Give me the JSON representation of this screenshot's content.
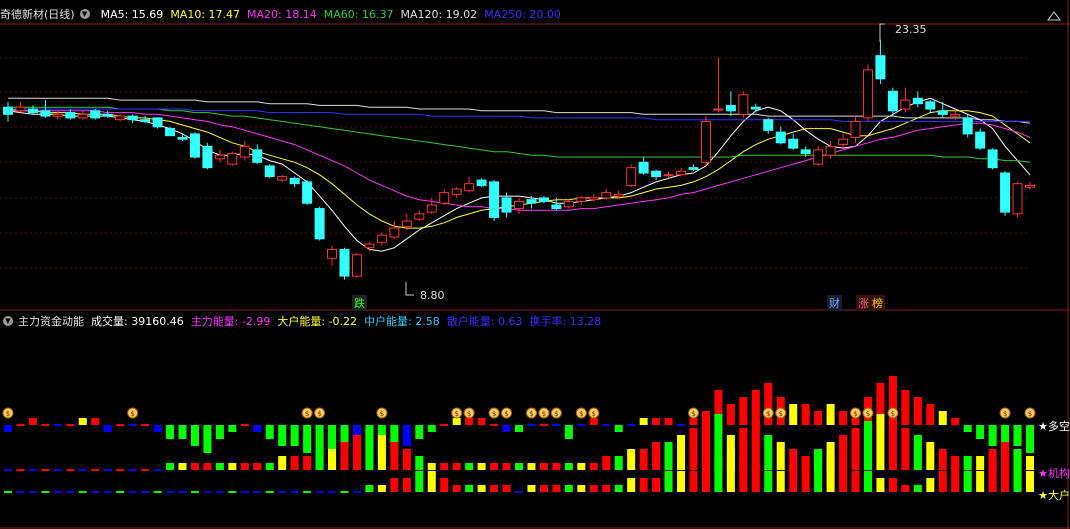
{
  "top_panel": {
    "title": "奇德新材(日线)",
    "ma": [
      {
        "label": "MA5: 15.69",
        "color": "#ffffff"
      },
      {
        "label": "MA10: 17.47",
        "color": "#ffff33"
      },
      {
        "label": "MA20: 18.14",
        "color": "#ff33ff"
      },
      {
        "label": "MA60: 16.37",
        "color": "#33cc33"
      },
      {
        "label": "MA120: 19.02",
        "color": "#dddddd"
      },
      {
        "label": "MA250: 20.00",
        "color": "#3333ff"
      }
    ],
    "high_label": "23.35",
    "low_label": "8.80",
    "tags": [
      {
        "text": "跌",
        "color": "#33ff33"
      },
      {
        "text": "财",
        "color": "#66aaff"
      },
      {
        "text": "涨",
        "color": "#ff5555"
      },
      {
        "text": "榜",
        "color": "#ffcc00"
      }
    ]
  },
  "bottom_panel": {
    "title": "主力资金动能",
    "items": [
      {
        "label": "成交量: 39160.46",
        "color": "#ffffff"
      },
      {
        "label": "主力能量: -2.99",
        "color": "#ff33ff"
      },
      {
        "label": "大户能量: -0.22",
        "color": "#ffff33"
      },
      {
        "label": "中户能量: 2.58",
        "color": "#33ccff"
      },
      {
        "label": "散户能量: 0.63",
        "color": "#3333ff"
      },
      {
        "label": "换手率: 13.28",
        "color": "#3333ff"
      }
    ],
    "right_labels": [
      {
        "text": "★多空",
        "color": "#ffffff"
      },
      {
        "text": "★机构",
        "color": "#ff33ff"
      },
      {
        "text": "★大户",
        "color": "#ffff33"
      }
    ]
  },
  "chart_data": {
    "type": "candlestick",
    "candles": [
      [
        11,
        10.6,
        11.3,
        10.2
      ],
      [
        10.8,
        11,
        11.3,
        10.7
      ],
      [
        10.9,
        10.7,
        11.1,
        10.6
      ],
      [
        10.8,
        10.5,
        11.4,
        10.4
      ],
      [
        10.5,
        10.6,
        10.8,
        10.3
      ],
      [
        10.7,
        10.4,
        10.9,
        10.3
      ],
      [
        10.4,
        10.6,
        10.8,
        10.3
      ],
      [
        10.8,
        10.4,
        10.9,
        10.3
      ],
      [
        10.6,
        10.5,
        10.8,
        10.4
      ],
      [
        10.3,
        10.5,
        10.6,
        10.2
      ],
      [
        10.5,
        10.3,
        10.6,
        10.1
      ],
      [
        10.3,
        10.2,
        10.5,
        10.1
      ],
      [
        10.4,
        9.9,
        10.4,
        9.8
      ],
      [
        9.8,
        9.4,
        9.9,
        9.4
      ],
      [
        9.3,
        9.2,
        9.5,
        9.1
      ],
      [
        9.5,
        8.2,
        9.6,
        8.1
      ],
      [
        8.8,
        7.6,
        9,
        7.5
      ],
      [
        8.1,
        8.3,
        8.6,
        7.9
      ],
      [
        7.8,
        8.4,
        8.5,
        7.7
      ],
      [
        8.2,
        8.8,
        9.1,
        8
      ],
      [
        8.6,
        7.9,
        8.9,
        7.8
      ],
      [
        7.7,
        7.1,
        7.8,
        7.0
      ],
      [
        6.9,
        7.1,
        7.2,
        6.8
      ],
      [
        7,
        6.7,
        7.1,
        6.5
      ],
      [
        6.8,
        5.6,
        6.9,
        5.5
      ],
      [
        5.3,
        3.6,
        5.4,
        3.5
      ],
      [
        2.5,
        3,
        3.2,
        2.1
      ],
      [
        3,
        1.5,
        3.1,
        1.3
      ],
      [
        1.5,
        2.7,
        2.8,
        1.4
      ],
      [
        3.1,
        3.3,
        3.4,
        2.9
      ],
      [
        3.4,
        3.8,
        4,
        3.2
      ],
      [
        3.7,
        4.2,
        4.6,
        3.6
      ],
      [
        4.3,
        4.6,
        5,
        4.1
      ],
      [
        4.7,
        5,
        5.2,
        4.6
      ],
      [
        5.1,
        5.5,
        5.9,
        5
      ],
      [
        5.6,
        6.2,
        6.4,
        5.5
      ],
      [
        6.1,
        6.4,
        6.5,
        5.9
      ],
      [
        6.3,
        6.7,
        7.1,
        6.2
      ],
      [
        6.9,
        6.6,
        7,
        6.5
      ],
      [
        6.8,
        4.8,
        6.9,
        4.6
      ],
      [
        5.9,
        5.1,
        6.2,
        4.8
      ],
      [
        5.3,
        5.7,
        5.9,
        5
      ],
      [
        5.8,
        5.6,
        6,
        5.3
      ],
      [
        5.9,
        5.7,
        6,
        5.6
      ],
      [
        5.5,
        5.3,
        5.9,
        5.2
      ],
      [
        5.4,
        5.7,
        5.8,
        5.3
      ],
      [
        5.7,
        5.9,
        6.0,
        5.5
      ],
      [
        5.8,
        5.9,
        6.1,
        5.7
      ],
      [
        5.9,
        6.2,
        6.4,
        5.8
      ],
      [
        6,
        6.1,
        6.3,
        5.9
      ],
      [
        6.6,
        7.6,
        7.8,
        6.5
      ],
      [
        7.9,
        7.3,
        8.2,
        7.2
      ],
      [
        7.4,
        7.1,
        7.5,
        6.9
      ],
      [
        7.2,
        7.2,
        7.4,
        7.0
      ],
      [
        7.2,
        7.4,
        7.6,
        7.1
      ],
      [
        7.6,
        7.5,
        7.8,
        7.4
      ],
      [
        7.9,
        10.2,
        10.5,
        7.7
      ],
      [
        10.9,
        10.9,
        13.8,
        10.7
      ],
      [
        11.1,
        10.8,
        11.9,
        10.5
      ],
      [
        10.6,
        11.7,
        11.9,
        10.4
      ],
      [
        11,
        10.9,
        11.2,
        10.7
      ],
      [
        10.3,
        9.7,
        10.4,
        9.5
      ],
      [
        9.6,
        9,
        9.9,
        8.9
      ],
      [
        9.2,
        8.7,
        9.5,
        8.6
      ],
      [
        8.6,
        8.4,
        8.8,
        8.2
      ],
      [
        7.8,
        8.6,
        8.8,
        7.7
      ],
      [
        8.3,
        8.8,
        9.1,
        8.1
      ],
      [
        8.9,
        9.2,
        9.5,
        8.7
      ],
      [
        9.3,
        10.2,
        10.5,
        9
      ],
      [
        10.4,
        13.1,
        13.4,
        10.2
      ],
      [
        13.9,
        12.6,
        14.8,
        12.3
      ],
      [
        11.9,
        10.8,
        12.1,
        10.5
      ],
      [
        10.9,
        11.4,
        12.1,
        10.7
      ],
      [
        11.5,
        11.2,
        11.9,
        11.0
      ],
      [
        11.3,
        10.9,
        11.4,
        10.7
      ],
      [
        10.8,
        10.6,
        11.3,
        10.4
      ],
      [
        10.5,
        10.6,
        10.9,
        10.3
      ],
      [
        10.4,
        9.5,
        10.6,
        9.3
      ],
      [
        9.6,
        8.7,
        9.8,
        8.6
      ],
      [
        8.6,
        7.6,
        8.7,
        7.5
      ],
      [
        7.3,
        5.1,
        7.4,
        4.9
      ],
      [
        5.0,
        6.7,
        6.8,
        4.8
      ],
      [
        6.5,
        6.6,
        6.8,
        6.4
      ]
    ],
    "ma": {
      "MA5": [
        10.8,
        10.7,
        10.6,
        10.6,
        10.6,
        10.5,
        10.5,
        10.5,
        10.5,
        10.4,
        10.3,
        10.2,
        10.0,
        9.8,
        9.5,
        9.1,
        8.6,
        8.3,
        8.3,
        8.4,
        8.3,
        8.0,
        7.8,
        7.3,
        6.8,
        6.0,
        5.2,
        4.3,
        3.5,
        3.0,
        2.9,
        3.1,
        3.6,
        4.1,
        4.5,
        4.9,
        5.3,
        5.6,
        5.9,
        6.0,
        6.0,
        6.0,
        5.9,
        5.8,
        5.6,
        5.6,
        5.7,
        5.8,
        5.9,
        6.0,
        6.2,
        6.5,
        6.8,
        7.0,
        7.2,
        7.3,
        7.7,
        8.5,
        9.4,
        10.2,
        10.8,
        11.0,
        10.8,
        10.3,
        9.7,
        9.2,
        8.8,
        8.7,
        8.8,
        9.4,
        10.2,
        10.6,
        11.0,
        11.3,
        11.5,
        11.2,
        10.9,
        10.6,
        10.3,
        9.8,
        8.8,
        8.0,
        7.2
      ],
      "MA10": [
        10.9,
        10.8,
        10.8,
        10.7,
        10.7,
        10.7,
        10.6,
        10.6,
        10.6,
        10.5,
        10.4,
        10.4,
        10.3,
        10.2,
        10.0,
        9.8,
        9.6,
        9.3,
        9.0,
        8.8,
        8.5,
        8.3,
        8.1,
        7.9,
        7.6,
        7.2,
        6.7,
        6.1,
        5.5,
        5.0,
        4.6,
        4.3,
        4.2,
        4.2,
        4.3,
        4.5,
        4.8,
        5.0,
        5.2,
        5.3,
        5.4,
        5.5,
        5.6,
        5.7,
        5.8,
        5.8,
        5.9,
        5.9,
        5.9,
        5.9,
        6.0,
        6.2,
        6.4,
        6.5,
        6.6,
        6.8,
        7.1,
        7.5,
        8.0,
        8.5,
        8.9,
        9.2,
        9.4,
        9.6,
        9.8,
        9.8,
        9.8,
        9.6,
        9.4,
        9.4,
        9.6,
        9.8,
        10.1,
        10.4,
        10.7,
        10.8,
        10.8,
        10.8,
        10.7,
        10.5,
        10.0,
        9.5,
        9.0
      ],
      "MA20": [
        10.8,
        10.8,
        10.8,
        10.8,
        10.8,
        10.8,
        10.8,
        10.8,
        10.7,
        10.7,
        10.7,
        10.6,
        10.6,
        10.5,
        10.4,
        10.3,
        10.2,
        10.0,
        9.9,
        9.7,
        9.5,
        9.3,
        9.1,
        8.9,
        8.6,
        8.3,
        8.0,
        7.7,
        7.3,
        6.9,
        6.6,
        6.3,
        6.0,
        5.8,
        5.7,
        5.6,
        5.5,
        5.4,
        5.4,
        5.3,
        5.3,
        5.2,
        5.2,
        5.2,
        5.2,
        5.2,
        5.3,
        5.3,
        5.4,
        5.5,
        5.6,
        5.7,
        5.8,
        5.9,
        6.1,
        6.2,
        6.4,
        6.6,
        6.8,
        7.0,
        7.2,
        7.4,
        7.6,
        7.8,
        8.0,
        8.2,
        8.4,
        8.6,
        8.8,
        9.0,
        9.2,
        9.3,
        9.5,
        9.7,
        9.8,
        9.9,
        10.0,
        10.1,
        10.1,
        10.0,
        9.8,
        9.6,
        9.3
      ],
      "MA60": [
        11.0,
        11.0,
        11.0,
        11.0,
        11.0,
        11.0,
        11.0,
        11.0,
        11.0,
        10.9,
        10.9,
        10.9,
        10.9,
        10.8,
        10.8,
        10.7,
        10.7,
        10.6,
        10.5,
        10.5,
        10.4,
        10.3,
        10.2,
        10.1,
        10.0,
        9.9,
        9.8,
        9.7,
        9.6,
        9.5,
        9.4,
        9.3,
        9.2,
        9.1,
        9.0,
        8.9,
        8.8,
        8.7,
        8.6,
        8.5,
        8.5,
        8.4,
        8.3,
        8.3,
        8.2,
        8.2,
        8.2,
        8.2,
        8.2,
        8.2,
        8.2,
        8.2,
        8.2,
        8.2,
        8.2,
        8.2,
        8.2,
        8.2,
        8.2,
        8.3,
        8.3,
        8.3,
        8.3,
        8.3,
        8.3,
        8.3,
        8.3,
        8.3,
        8.3,
        8.3,
        8.3,
        8.3,
        8.3,
        8.3,
        8.3,
        8.2,
        8.2,
        8.2,
        8.1,
        8.1,
        8.0,
        8.0,
        7.9
      ],
      "MA120": [
        11.5,
        11.5,
        11.5,
        11.5,
        11.5,
        11.5,
        11.5,
        11.5,
        11.5,
        11.4,
        11.4,
        11.4,
        11.4,
        11.4,
        11.4,
        11.4,
        11.3,
        11.3,
        11.3,
        11.3,
        11.3,
        11.2,
        11.2,
        11.2,
        11.2,
        11.1,
        11.1,
        11.1,
        11.1,
        11.0,
        11.0,
        11.0,
        11.0,
        10.9,
        10.9,
        10.9,
        10.9,
        10.9,
        10.8,
        10.8,
        10.8,
        10.8,
        10.8,
        10.8,
        10.7,
        10.7,
        10.7,
        10.7,
        10.7,
        10.7,
        10.7,
        10.6,
        10.6,
        10.6,
        10.6,
        10.6,
        10.6,
        10.6,
        10.6,
        10.6,
        10.6,
        10.5,
        10.5,
        10.5,
        10.5,
        10.5,
        10.5,
        10.5,
        10.5,
        10.5,
        10.5,
        10.5,
        10.4,
        10.4,
        10.4,
        10.4,
        10.4,
        10.4,
        10.3,
        10.3,
        10.2,
        10.2,
        10.1
      ],
      "MA250": [
        10.9,
        10.9,
        10.9,
        10.9,
        10.9,
        10.9,
        10.9,
        10.9,
        10.9,
        10.9,
        10.9,
        10.9,
        10.9,
        10.9,
        10.9,
        10.8,
        10.8,
        10.8,
        10.8,
        10.8,
        10.8,
        10.7,
        10.7,
        10.7,
        10.7,
        10.7,
        10.7,
        10.6,
        10.6,
        10.6,
        10.6,
        10.6,
        10.6,
        10.6,
        10.5,
        10.5,
        10.5,
        10.5,
        10.5,
        10.5,
        10.5,
        10.5,
        10.4,
        10.4,
        10.4,
        10.4,
        10.4,
        10.4,
        10.4,
        10.4,
        10.4,
        10.4,
        10.3,
        10.3,
        10.3,
        10.3,
        10.3,
        10.3,
        10.3,
        10.3,
        10.3,
        10.3,
        10.3,
        10.3,
        10.3,
        10.3,
        10.3,
        10.2,
        10.2,
        10.2,
        10.2,
        10.2,
        10.2,
        10.2,
        10.2,
        10.2,
        10.2,
        10.2,
        10.2,
        10.2,
        10.2,
        10.2,
        10.2
      ]
    },
    "bars_row1": [
      -1,
      0,
      1,
      0,
      0,
      0,
      1,
      1,
      -1,
      0,
      0,
      0,
      -1,
      -2,
      -2,
      -3,
      -4,
      -2,
      -1,
      0,
      -1,
      -2,
      -3,
      -3,
      -4,
      -5,
      -6,
      -6,
      -3,
      -4,
      -5,
      -4,
      -3,
      -2,
      -1,
      0,
      1,
      1,
      1,
      0,
      -1,
      -1,
      0,
      0,
      0,
      -2,
      0,
      1,
      0,
      -1,
      0,
      1,
      1,
      1,
      0,
      1,
      2,
      5,
      3,
      4,
      5,
      6,
      4,
      3,
      3,
      2,
      3,
      2,
      1,
      4,
      6,
      7,
      5,
      4,
      3,
      2,
      1,
      -1,
      -2,
      -3,
      -5,
      -3,
      -4
    ],
    "bars_row2": [
      0,
      0,
      0,
      0,
      0,
      0,
      0,
      0,
      0,
      0,
      0,
      0,
      0,
      1,
      1,
      1,
      1,
      1,
      1,
      1,
      1,
      1,
      2,
      2,
      2,
      2,
      3,
      4,
      5,
      6,
      5,
      4,
      3,
      2,
      1,
      1,
      1,
      1,
      1,
      1,
      1,
      1,
      1,
      1,
      1,
      1,
      1,
      1,
      2,
      2,
      3,
      3,
      4,
      4,
      5,
      6,
      7,
      8,
      5,
      6,
      7,
      5,
      4,
      3,
      2,
      3,
      4,
      5,
      6,
      7,
      8,
      9,
      6,
      5,
      4,
      3,
      2,
      2,
      2,
      3,
      4,
      3,
      2
    ],
    "bars_row3": [
      0,
      0,
      0,
      0,
      0,
      0,
      0,
      0,
      0,
      0,
      0,
      0,
      0,
      0,
      0,
      0,
      0,
      0,
      0,
      0,
      0,
      0,
      0,
      0,
      0,
      0,
      0,
      0,
      0,
      1,
      1,
      2,
      2,
      3,
      3,
      2,
      1,
      1,
      1,
      1,
      1,
      0,
      1,
      1,
      1,
      1,
      1,
      1,
      1,
      1,
      2,
      2,
      2,
      3,
      3,
      3,
      4,
      5,
      6,
      5,
      4,
      3,
      3,
      4,
      5,
      6,
      5,
      4,
      3,
      3,
      2,
      2,
      1,
      1,
      2,
      3,
      4,
      3,
      3,
      4,
      5,
      5,
      3
    ],
    "coin_positions": [
      0,
      7,
      17,
      18,
      22,
      26,
      27,
      28,
      29,
      30,
      31,
      32,
      33,
      34,
      40,
      44,
      45,
      49,
      50,
      51,
      58,
      59
    ]
  }
}
